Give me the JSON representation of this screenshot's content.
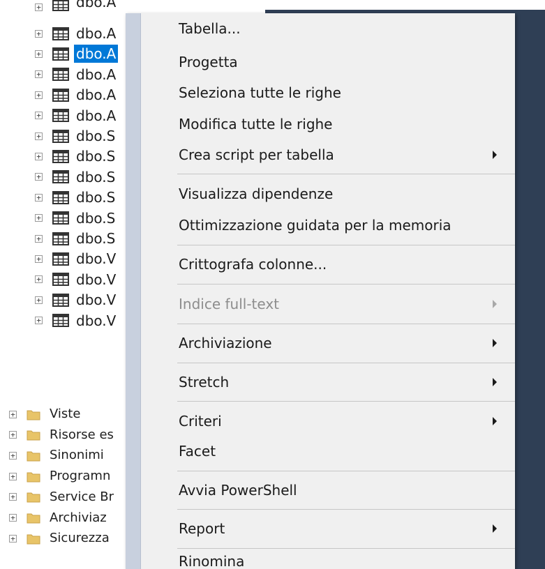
{
  "tree": {
    "top_partial_label": "dbo.A",
    "tables": [
      {
        "label": "dbo.A",
        "selected": false
      },
      {
        "label": "dbo.A",
        "selected": true
      },
      {
        "label": "dbo.A",
        "selected": false
      },
      {
        "label": "dbo.A",
        "selected": false
      },
      {
        "label": "dbo.A",
        "selected": false
      },
      {
        "label": "dbo.S",
        "selected": false
      },
      {
        "label": "dbo.S",
        "selected": false
      },
      {
        "label": "dbo.S",
        "selected": false
      },
      {
        "label": "dbo.S",
        "selected": false
      },
      {
        "label": "dbo.S",
        "selected": false
      },
      {
        "label": "dbo.S",
        "selected": false
      },
      {
        "label": "dbo.V",
        "selected": false
      },
      {
        "label": "dbo.V",
        "selected": false
      },
      {
        "label": "dbo.V",
        "selected": false
      },
      {
        "label": "dbo.V",
        "selected": false
      }
    ],
    "folders": [
      {
        "label": "Viste"
      },
      {
        "label": "Risorse es"
      },
      {
        "label": "Sinonimi"
      },
      {
        "label": "Programn"
      },
      {
        "label": "Service Br"
      },
      {
        "label": "Archiviaz"
      },
      {
        "label": "Sicurezza"
      }
    ],
    "expander_symbol": "+"
  },
  "context_menu": {
    "items": [
      {
        "label": "Tabella...",
        "submenu": false,
        "disabled": false
      },
      {
        "label": "Progetta",
        "submenu": false,
        "disabled": false
      },
      {
        "label": "Seleziona tutte le righe",
        "submenu": false,
        "disabled": false
      },
      {
        "label": "Modifica tutte le righe",
        "submenu": false,
        "disabled": false
      },
      {
        "label": "Crea script per tabella",
        "submenu": true,
        "disabled": false
      },
      {
        "label": "Visualizza dipendenze",
        "submenu": false,
        "disabled": false
      },
      {
        "label": "Ottimizzazione guidata per la memoria",
        "submenu": false,
        "disabled": false
      },
      {
        "label": "Crittografa colonne...",
        "submenu": false,
        "disabled": false
      },
      {
        "label": "Indice full-text",
        "submenu": true,
        "disabled": true
      },
      {
        "label": "Archiviazione",
        "submenu": true,
        "disabled": false
      },
      {
        "label": "Stretch",
        "submenu": true,
        "disabled": false
      },
      {
        "label": "Criteri",
        "submenu": true,
        "disabled": false
      },
      {
        "label": "Facet",
        "submenu": false,
        "disabled": false
      },
      {
        "label": "Avvia PowerShell",
        "submenu": false,
        "disabled": false
      },
      {
        "label": "Report",
        "submenu": true,
        "disabled": false
      },
      {
        "label": "Rinomina",
        "submenu": false,
        "disabled": false
      }
    ]
  },
  "colors": {
    "selection": "#0078d7",
    "menu_background": "#f0f0f0",
    "menu_gutter": "#c8d0de",
    "dark_background": "#2f3f55",
    "folder": "#e8c468"
  }
}
